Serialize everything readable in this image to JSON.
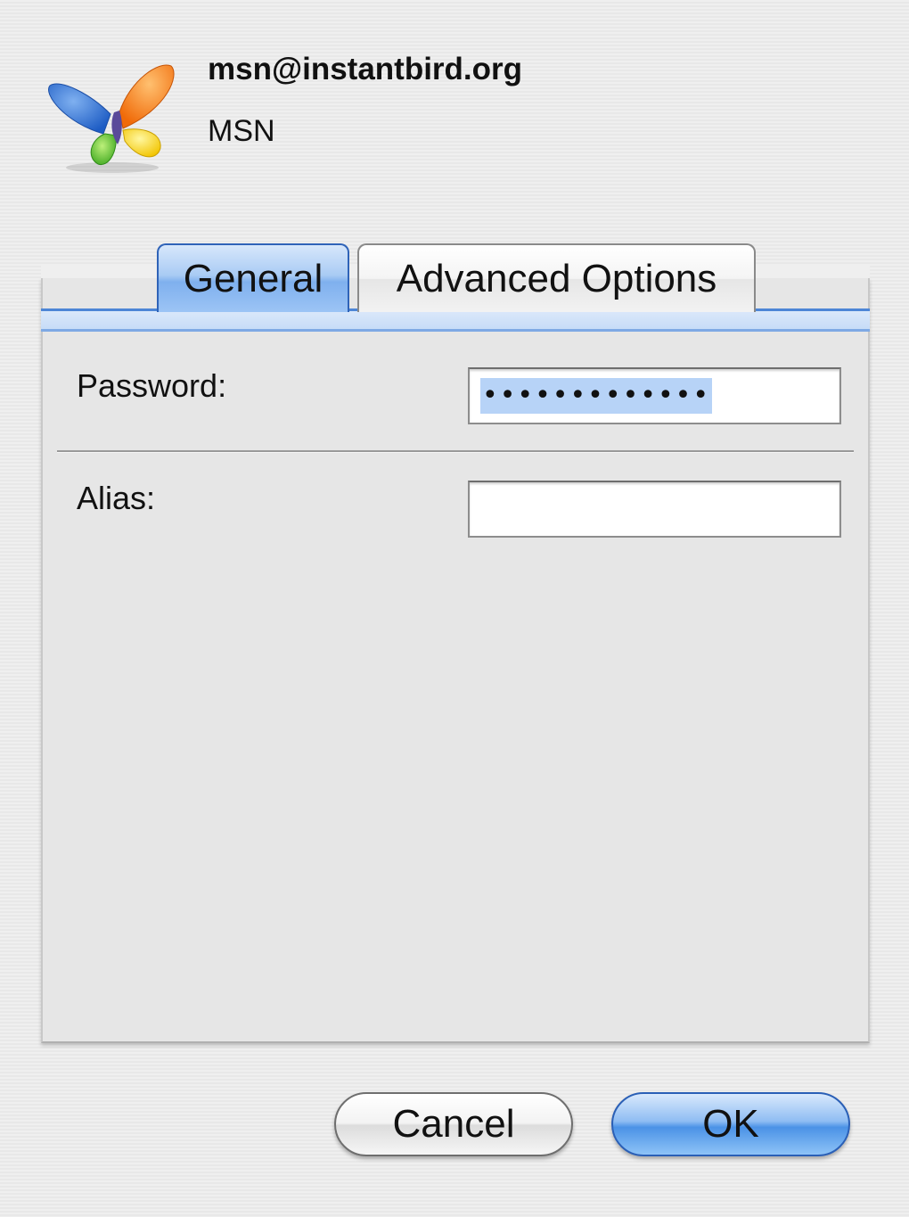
{
  "account": {
    "name": "msn@instantbird.org",
    "protocol": "MSN",
    "icon": "msn-butterfly-icon"
  },
  "tabs": [
    {
      "label": "General",
      "selected": true
    },
    {
      "label": "Advanced Options",
      "selected": false
    }
  ],
  "form": {
    "password": {
      "label": "Password:",
      "value": "•••••••••••••",
      "selected": true
    },
    "alias": {
      "label": "Alias:",
      "value": ""
    }
  },
  "buttons": {
    "cancel": "Cancel",
    "ok": "OK"
  },
  "colors": {
    "accent": "#4b92e6",
    "selection": "#b7d3f7",
    "window_background": "#ececec"
  }
}
